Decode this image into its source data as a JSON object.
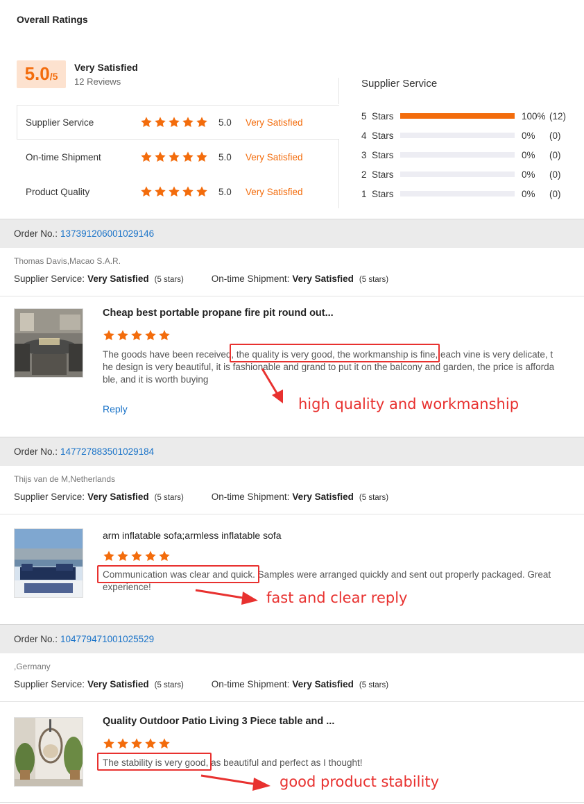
{
  "overall": {
    "title": "Overall Ratings",
    "score": "5.0",
    "score_of": "/5",
    "summary_label": "Very Satisfied",
    "review_count": "12 Reviews"
  },
  "ratings": [
    {
      "label": "Supplier Service",
      "score": "5.0",
      "verdict": "Very Satisfied",
      "stars": 5
    },
    {
      "label": "On-time Shipment",
      "score": "5.0",
      "verdict": "Very Satisfied",
      "stars": 5
    },
    {
      "label": "Product Quality",
      "score": "5.0",
      "verdict": "Very Satisfied",
      "stars": 5
    }
  ],
  "distribution": {
    "title": "Supplier Service",
    "rows": [
      {
        "num": "5",
        "word": "Stars",
        "fraction": 1.0,
        "pct": "100%",
        "count": "(12)"
      },
      {
        "num": "4",
        "word": "Stars",
        "fraction": 0,
        "pct": "0%",
        "count": "(0)"
      },
      {
        "num": "3",
        "word": "Stars",
        "fraction": 0,
        "pct": "0%",
        "count": "(0)"
      },
      {
        "num": "2",
        "word": "Stars",
        "fraction": 0,
        "pct": "0%",
        "count": "(0)"
      },
      {
        "num": "1",
        "word": "Stars",
        "fraction": 0,
        "pct": "0%",
        "count": "(0)"
      }
    ]
  },
  "labels": {
    "order_no": "Order No.:",
    "supplier_service": "Supplier Service:",
    "ontime_shipment": "On-time Shipment:",
    "reply": "Reply"
  },
  "colors": {
    "accent": "#f36c0c",
    "link": "#1a73c8",
    "annotation": "#e8312f"
  },
  "orders": [
    {
      "order_no": "137391206001029146",
      "buyer": "Thomas Davis,Macao S.A.R.",
      "supplier_verdict": "Very Satisfied",
      "supplier_stars": "(5 stars)",
      "shipment_verdict": "Very Satisfied",
      "shipment_stars": "(5 stars)",
      "product_title": "Cheap best portable propane fire pit round out...",
      "review_text": "The goods have been received, the quality is very good, the workmanship is fine, each vine is very delicate, the design is very beautiful, it is fashionable and grand to put it on the balcony and garden, the price is affordable, and it is worth buying",
      "reply": "Reply",
      "annotation": "high quality and workmanship"
    },
    {
      "order_no": "147727883501029184",
      "buyer": "Thijs van de M,Netherlands",
      "supplier_verdict": "Very Satisfied",
      "supplier_stars": "(5 stars)",
      "shipment_verdict": "Very Satisfied",
      "shipment_stars": "(5 stars)",
      "product_title": "arm inflatable sofa;armless inflatable sofa",
      "review_text": "Communication was clear and quick. Samples were arranged quickly and sent out properly packaged. Great experience!",
      "annotation": "fast and clear reply"
    },
    {
      "order_no": "104779471001025529",
      "buyer": ",Germany",
      "supplier_verdict": "Very Satisfied",
      "supplier_stars": "(5 stars)",
      "shipment_verdict": "Very Satisfied",
      "shipment_stars": "(5 stars)",
      "product_title": "Quality Outdoor Patio Living 3 Piece table and ...",
      "review_text": "The stability is very good, as beautiful and perfect as I thought!",
      "annotation": "good product stability"
    }
  ]
}
